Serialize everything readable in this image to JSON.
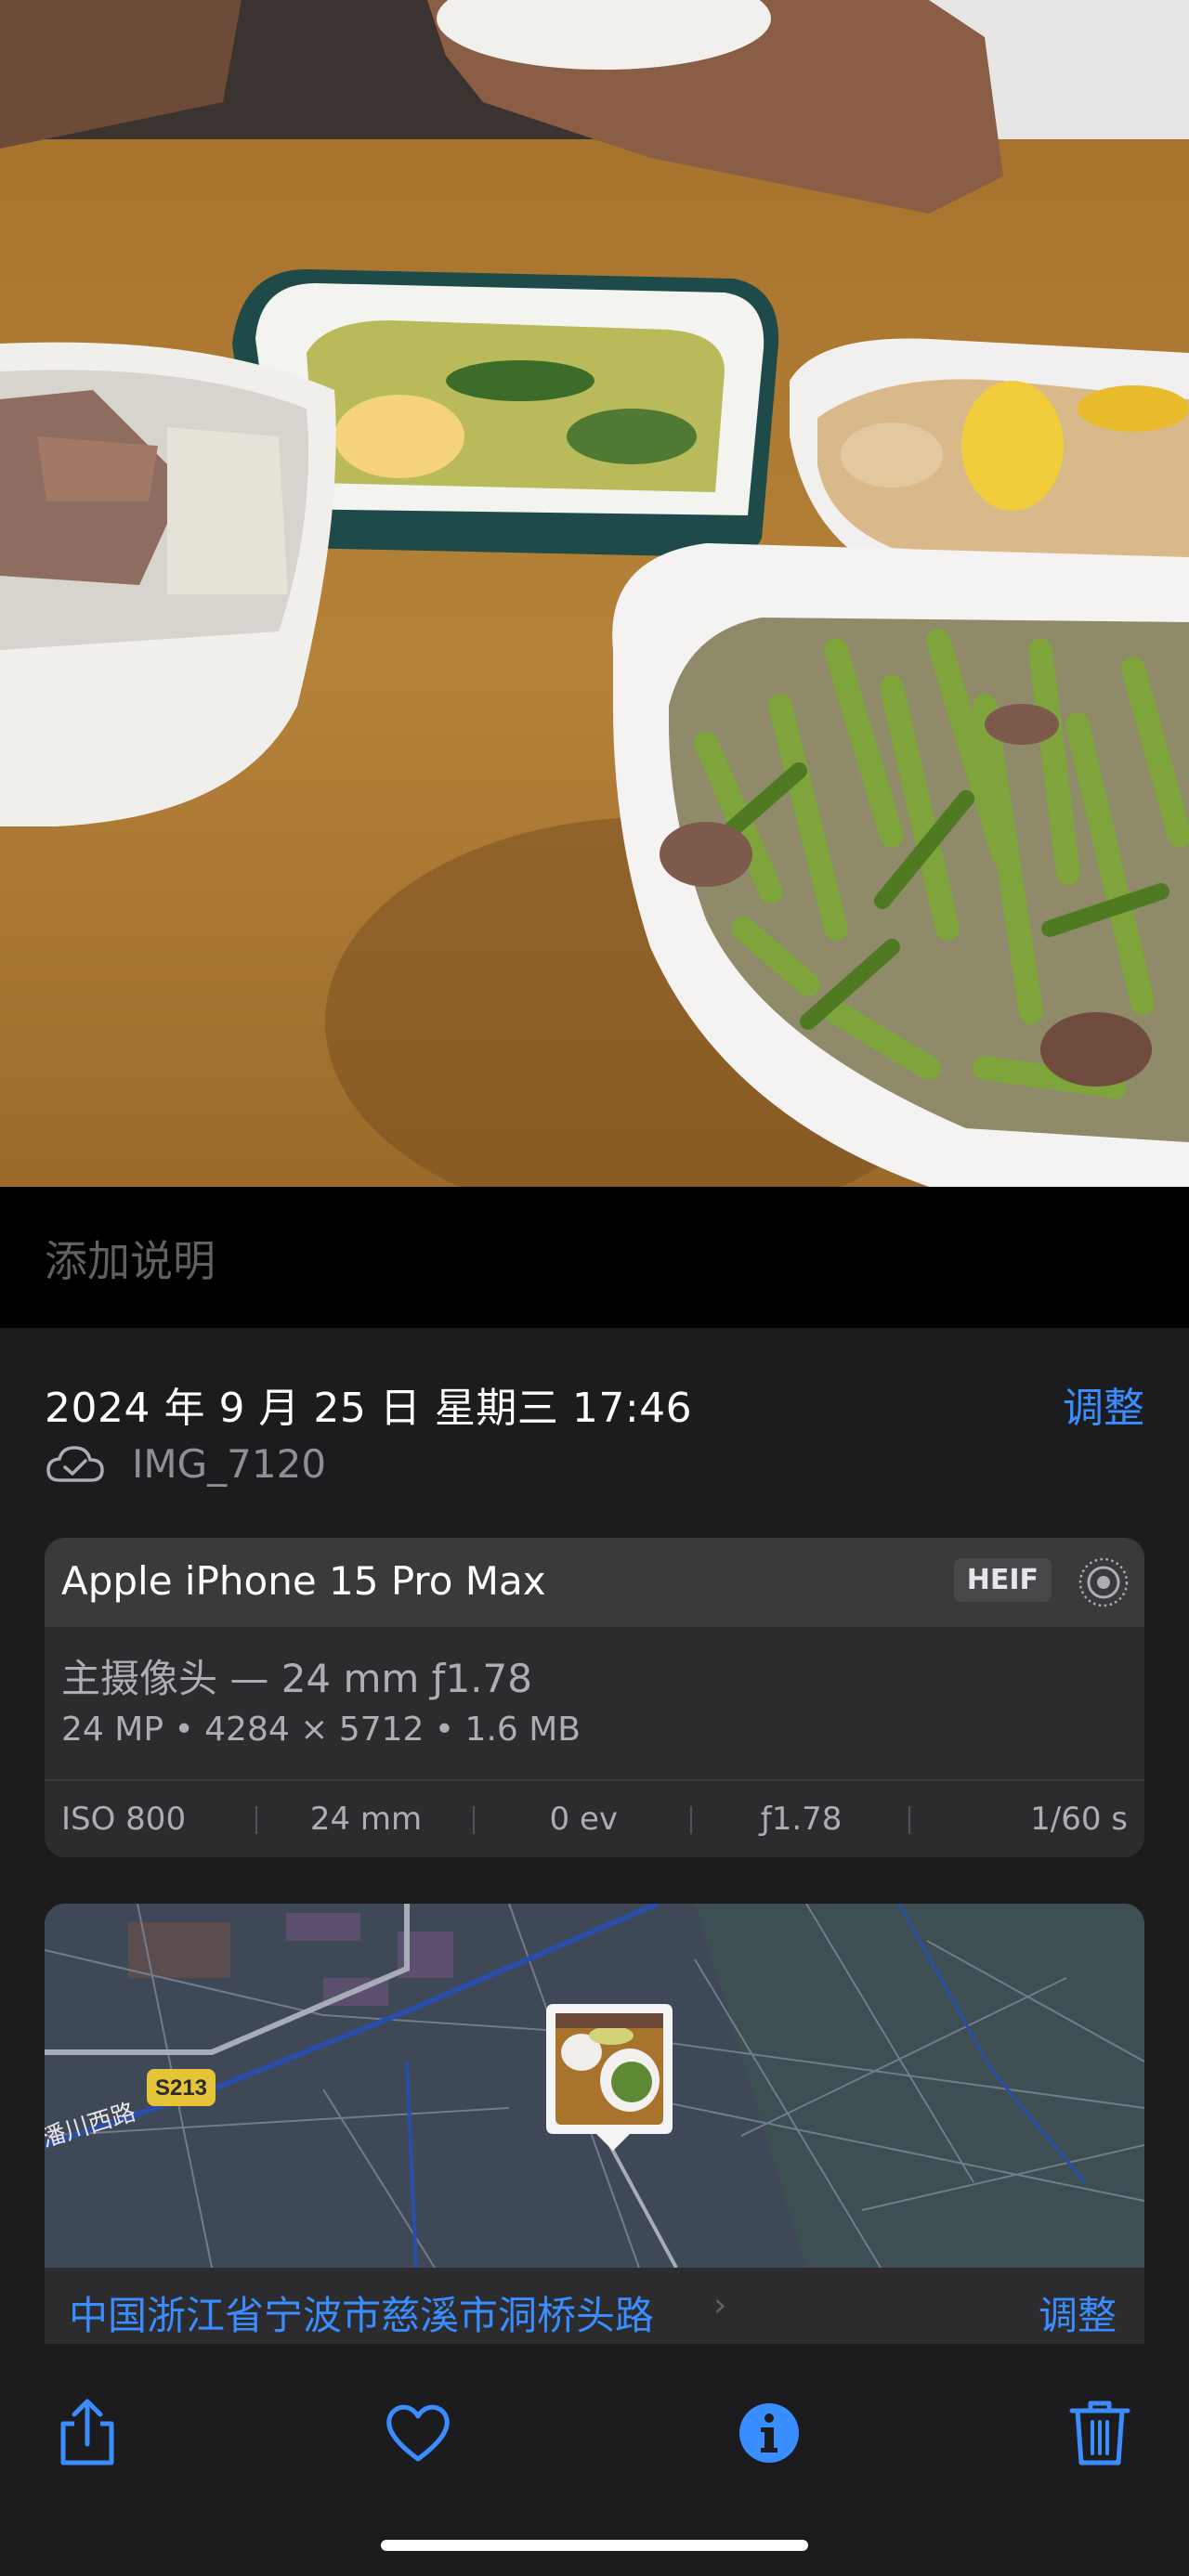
{
  "caption": {
    "placeholder": "添加说明"
  },
  "info": {
    "datetime": "2024 年 9 月 25 日 星期三 17:46",
    "adjust_label": "调整",
    "cloud_icon": "icloud-check-icon",
    "filename": "IMG_7120"
  },
  "camera": {
    "device": "Apple iPhone 15 Pro Max",
    "format_badge": "HEIF",
    "live_icon": "live-photo-icon",
    "lens": "主摄像头 — 24 mm ƒ1.78",
    "specs": "24 MP • 4284 × 5712 • 1.6 MB",
    "exif": [
      "ISO 800",
      "24 mm",
      "0 ev",
      "ƒ1.78",
      "1/60 s"
    ]
  },
  "map": {
    "road_badge": "S213",
    "road_label": "潘川西路",
    "location": "中国浙江省宁波市慈溪市洞桥头路",
    "adjust_label": "调整"
  },
  "toolbar": {
    "icons": [
      "share-icon",
      "favorite-heart-icon",
      "info-icon",
      "trash-icon"
    ],
    "accent": "#3a8dff"
  }
}
